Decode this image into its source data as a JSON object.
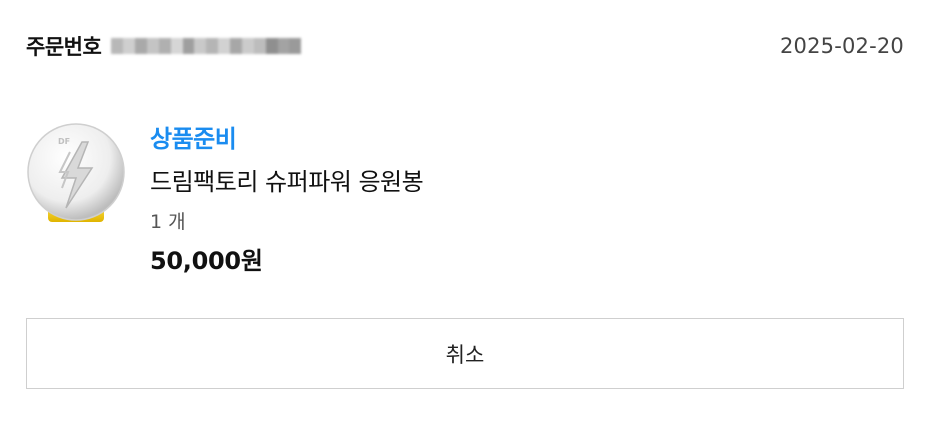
{
  "order": {
    "number_label": "주문번호",
    "date": "2025-02-20"
  },
  "product": {
    "status": "상품준비",
    "status_color": "#1a8cf0",
    "name": "드림팩토리 슈퍼파워 응원봉",
    "quantity": "1 개",
    "price": "50,000원",
    "image_icon": "lightstick-thumbnail-icon"
  },
  "actions": {
    "cancel_label": "취소"
  }
}
